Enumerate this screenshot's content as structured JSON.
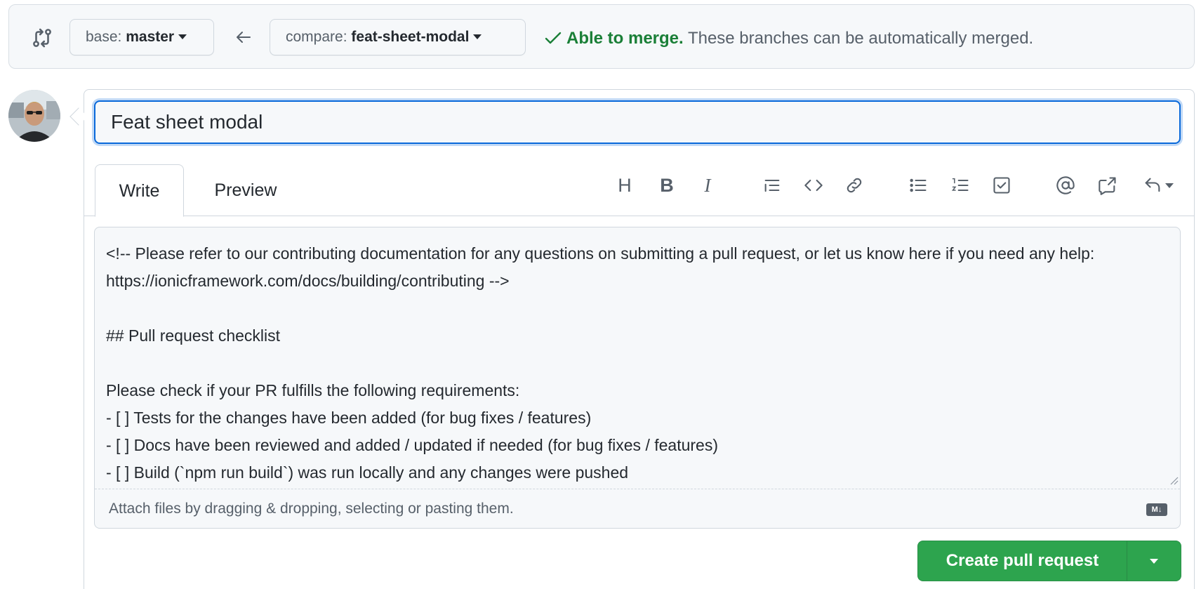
{
  "compare_bar": {
    "base_prefix": "base:",
    "base_branch": "master",
    "compare_prefix": "compare:",
    "compare_branch": "feat-sheet-modal",
    "merge_ok": "Able to merge.",
    "merge_detail": "These branches can be automatically merged."
  },
  "pr": {
    "title": "Feat sheet modal"
  },
  "tabs": [
    {
      "label": "Write",
      "active": true
    },
    {
      "label": "Preview",
      "active": false
    }
  ],
  "toolbar": {
    "heading": "H",
    "bold": "B",
    "italic": "I",
    "icons": [
      "heading-icon",
      "bold-icon",
      "italic-icon",
      "quote-icon",
      "code-icon",
      "link-icon",
      "unordered-list-icon",
      "ordered-list-icon",
      "task-list-icon",
      "mention-icon",
      "reference-icon",
      "saved-replies-icon"
    ]
  },
  "body": {
    "text": "<!-- Please refer to our contributing documentation for any questions on submitting a pull request, or let us know here if you need any help: https://ionicframework.com/docs/building/contributing -->\n\n## Pull request checklist\n\nPlease check if your PR fulfills the following requirements:\n- [ ] Tests for the changes have been added (for bug fixes / features)\n- [ ] Docs have been reviewed and added / updated if needed (for bug fixes / features)\n- [ ] Build (`npm run build`) was run locally and any changes were pushed",
    "attach_hint": "Attach files by dragging & dropping, selecting or pasting them.",
    "markdown_badge": "M↓"
  },
  "submit": {
    "label": "Create pull request"
  },
  "colors": {
    "success": "#1a7f37",
    "primary_button": "#2da44e",
    "focus": "#0969da"
  }
}
